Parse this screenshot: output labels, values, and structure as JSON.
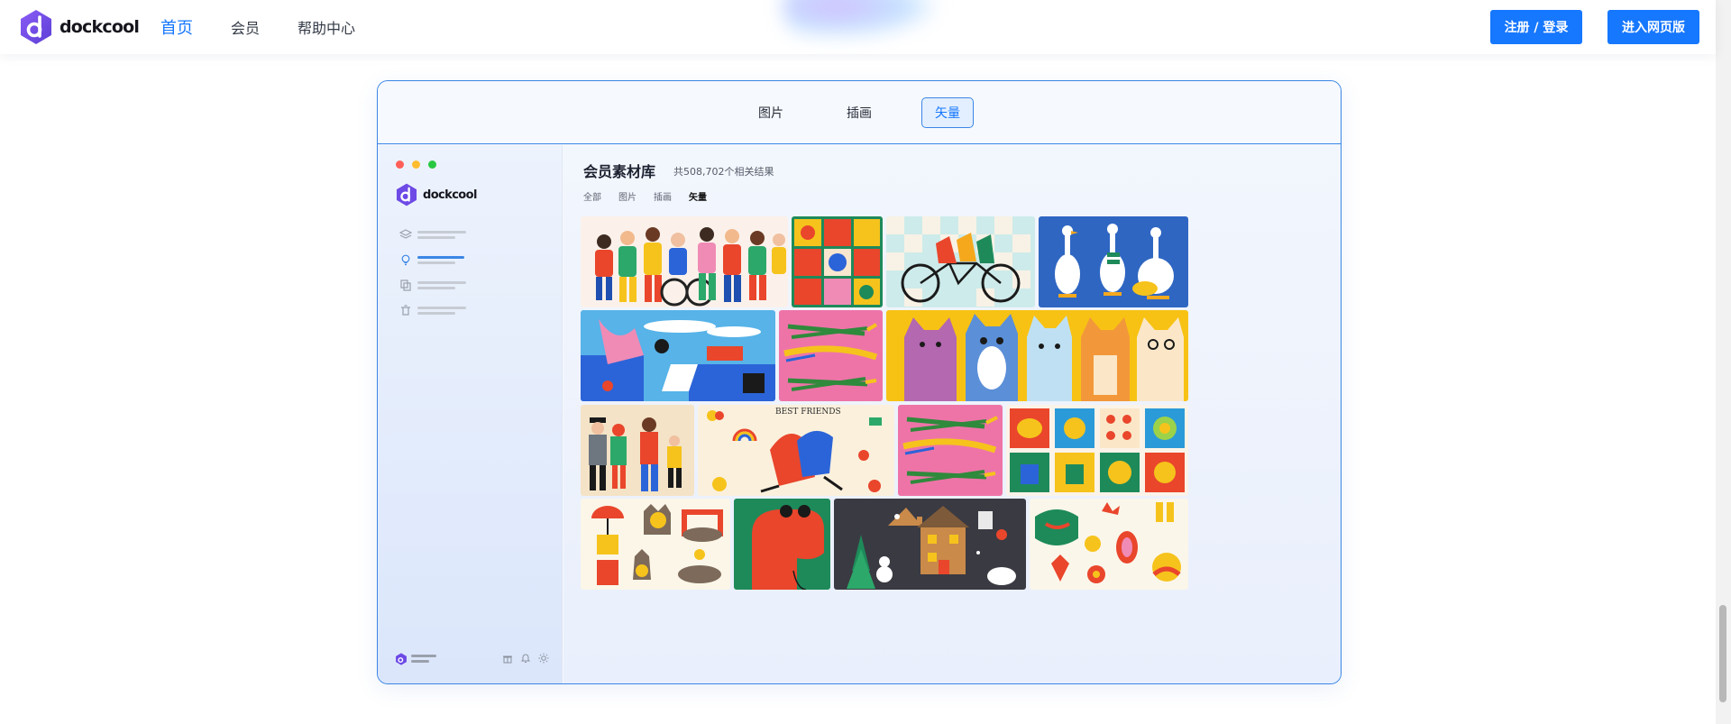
{
  "nav": {
    "brand": "dockcool",
    "items": [
      {
        "label": "首页",
        "active": true
      },
      {
        "label": "会员",
        "active": false
      },
      {
        "label": "帮助中心",
        "active": false
      }
    ],
    "register_label": "注册 / 登录",
    "web_label": "进入网页版"
  },
  "showcase": {
    "tabs": [
      {
        "label": "图片",
        "active": false
      },
      {
        "label": "插画",
        "active": false
      },
      {
        "label": "矢量",
        "active": true
      }
    ],
    "app": {
      "brand": "dockcool",
      "title": "会员素材库",
      "count": "共508,702个相关结果",
      "filters": [
        {
          "label": "全部",
          "active": false
        },
        {
          "label": "图片",
          "active": false
        },
        {
          "label": "插画",
          "active": false
        },
        {
          "label": "矢量",
          "active": true
        }
      ],
      "thumbnail_text": {
        "best_friends": "BEST FRIENDS"
      }
    }
  },
  "colors": {
    "accent": "#1677ff",
    "border": "#3b86e6",
    "window_red": "#ff5f57",
    "window_yellow": "#febc2e",
    "window_green": "#28c840"
  },
  "icons": [
    "logo-d-icon",
    "layers-icon",
    "lightbulb-icon",
    "copy-icon",
    "trash-icon",
    "gift-icon",
    "bell-icon",
    "sun-icon"
  ]
}
